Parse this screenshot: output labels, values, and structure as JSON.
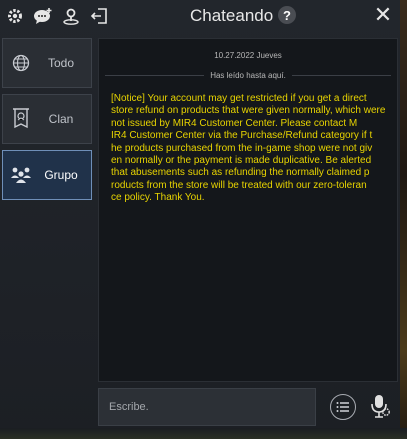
{
  "header": {
    "title": "Chateando",
    "help": "?",
    "close": "✕"
  },
  "sidebar": {
    "items": [
      {
        "label": "Todo",
        "icon": "globe-icon"
      },
      {
        "label": "Clan",
        "icon": "clan-banner-icon"
      },
      {
        "label": "Grupo",
        "icon": "group-icon",
        "active": true
      }
    ]
  },
  "chat": {
    "date": "10.27.2022 Jueves",
    "read_marker": "Has leído hasta aquí.",
    "message": "[Notice] Your account may get restricted if you get a direct\n store refund on products that were given normally, which were not issued by MIR4 Customer Center. Please contact M\nIR4 Customer Center via the Purchase/Refund category if t\nhe products purchased from the in-game shop were not giv\nen normally or the payment is made duplicative. Be alerted\nthat abusements such as refunding the normally claimed p\nroducts from the store will be treated with our zero-toleran\nce policy. Thank You.",
    "message_color": "#e8d400"
  },
  "input": {
    "placeholder": "Escribe."
  },
  "colors": {
    "accent": "#6f8fb8",
    "background": "#14171b"
  }
}
